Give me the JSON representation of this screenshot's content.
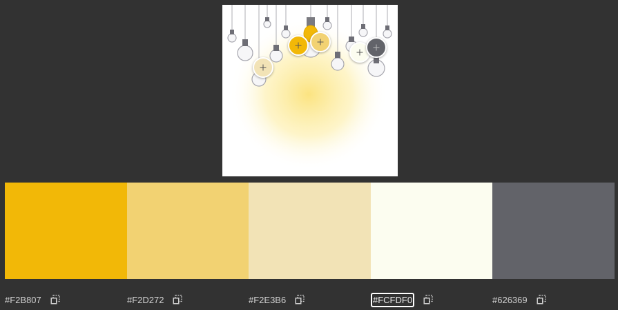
{
  "colors": {
    "background": "#323232",
    "swatches": [
      "#F2B807",
      "#F2D272",
      "#F2E3B6",
      "#FCFDF0",
      "#626369"
    ]
  },
  "palette": [
    {
      "hex": "#F2B807",
      "color": "#F2B807"
    },
    {
      "hex": "#F2D272",
      "color": "#F2D272"
    },
    {
      "hex": "#F2E3B6",
      "color": "#F2E3B6"
    },
    {
      "hex": "#FCFDF0",
      "color": "#FCFDF0"
    },
    {
      "hex": "#626369",
      "color": "#626369"
    }
  ],
  "selected_index": 3,
  "icons": {
    "sampler": "crosshair-plus-icon",
    "copy": "copy-icon"
  }
}
